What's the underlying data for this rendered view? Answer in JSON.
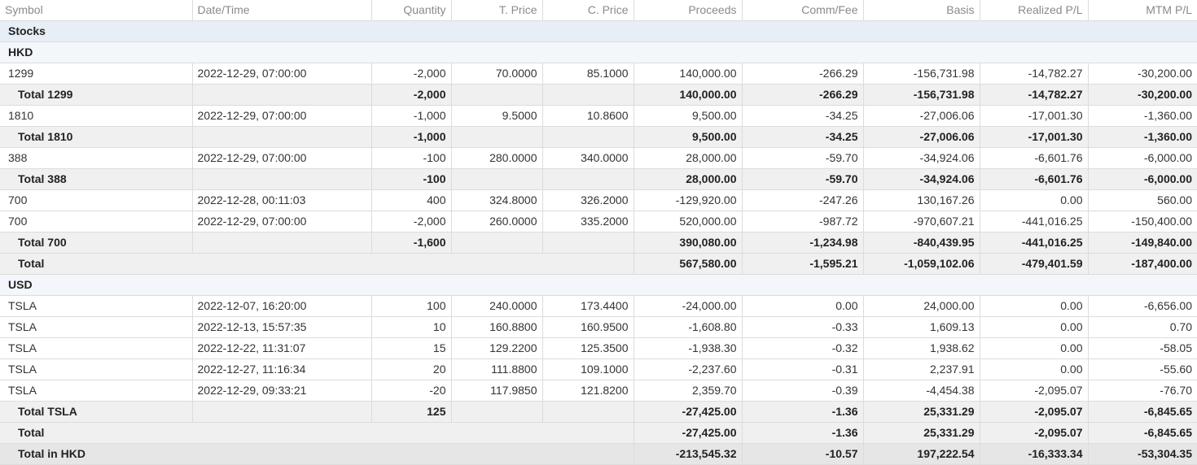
{
  "headers": [
    "Symbol",
    "Date/Time",
    "Quantity",
    "T. Price",
    "C. Price",
    "Proceeds",
    "Comm/Fee",
    "Basis",
    "Realized P/L",
    "MTM P/L"
  ],
  "section_label": "Stocks",
  "hkd": {
    "label": "HKD",
    "rows": [
      {
        "type": "row",
        "symbol": "1299",
        "datetime": "2022-12-29, 07:00:00",
        "qty": "-2,000",
        "tprice": "70.0000",
        "cprice": "85.1000",
        "proceeds": "140,000.00",
        "comm": "-266.29",
        "basis": "-156,731.98",
        "realized": "-14,782.27",
        "mtm": "-30,200.00"
      },
      {
        "type": "total",
        "symbol": "Total 1299",
        "datetime": "",
        "qty": "-2,000",
        "tprice": "",
        "cprice": "",
        "proceeds": "140,000.00",
        "comm": "-266.29",
        "basis": "-156,731.98",
        "realized": "-14,782.27",
        "mtm": "-30,200.00"
      },
      {
        "type": "row",
        "symbol": "1810",
        "datetime": "2022-12-29, 07:00:00",
        "qty": "-1,000",
        "tprice": "9.5000",
        "cprice": "10.8600",
        "proceeds": "9,500.00",
        "comm": "-34.25",
        "basis": "-27,006.06",
        "realized": "-17,001.30",
        "mtm": "-1,360.00"
      },
      {
        "type": "total",
        "symbol": "Total 1810",
        "datetime": "",
        "qty": "-1,000",
        "tprice": "",
        "cprice": "",
        "proceeds": "9,500.00",
        "comm": "-34.25",
        "basis": "-27,006.06",
        "realized": "-17,001.30",
        "mtm": "-1,360.00"
      },
      {
        "type": "row",
        "symbol": "388",
        "datetime": "2022-12-29, 07:00:00",
        "qty": "-100",
        "tprice": "280.0000",
        "cprice": "340.0000",
        "proceeds": "28,000.00",
        "comm": "-59.70",
        "basis": "-34,924.06",
        "realized": "-6,601.76",
        "mtm": "-6,000.00"
      },
      {
        "type": "total",
        "symbol": "Total 388",
        "datetime": "",
        "qty": "-100",
        "tprice": "",
        "cprice": "",
        "proceeds": "28,000.00",
        "comm": "-59.70",
        "basis": "-34,924.06",
        "realized": "-6,601.76",
        "mtm": "-6,000.00"
      },
      {
        "type": "row",
        "symbol": "700",
        "datetime": "2022-12-28, 00:11:03",
        "qty": "400",
        "tprice": "324.8000",
        "cprice": "326.2000",
        "proceeds": "-129,920.00",
        "comm": "-247.26",
        "basis": "130,167.26",
        "realized": "0.00",
        "mtm": "560.00"
      },
      {
        "type": "row",
        "symbol": "700",
        "datetime": "2022-12-29, 07:00:00",
        "qty": "-2,000",
        "tprice": "260.0000",
        "cprice": "335.2000",
        "proceeds": "520,000.00",
        "comm": "-987.72",
        "basis": "-970,607.21",
        "realized": "-441,016.25",
        "mtm": "-150,400.00"
      },
      {
        "type": "total",
        "symbol": "Total 700",
        "datetime": "",
        "qty": "-1,600",
        "tprice": "",
        "cprice": "",
        "proceeds": "390,080.00",
        "comm": "-1,234.98",
        "basis": "-840,439.95",
        "realized": "-441,016.25",
        "mtm": "-149,840.00"
      }
    ],
    "total": {
      "label": "Total",
      "proceeds": "567,580.00",
      "comm": "-1,595.21",
      "basis": "-1,059,102.06",
      "realized": "-479,401.59",
      "mtm": "-187,400.00"
    }
  },
  "usd": {
    "label": "USD",
    "rows": [
      {
        "type": "row",
        "symbol": "TSLA",
        "datetime": "2022-12-07, 16:20:00",
        "qty": "100",
        "tprice": "240.0000",
        "cprice": "173.4400",
        "proceeds": "-24,000.00",
        "comm": "0.00",
        "basis": "24,000.00",
        "realized": "0.00",
        "mtm": "-6,656.00"
      },
      {
        "type": "row",
        "symbol": "TSLA",
        "datetime": "2022-12-13, 15:57:35",
        "qty": "10",
        "tprice": "160.8800",
        "cprice": "160.9500",
        "proceeds": "-1,608.80",
        "comm": "-0.33",
        "basis": "1,609.13",
        "realized": "0.00",
        "mtm": "0.70"
      },
      {
        "type": "row",
        "symbol": "TSLA",
        "datetime": "2022-12-22, 11:31:07",
        "qty": "15",
        "tprice": "129.2200",
        "cprice": "125.3500",
        "proceeds": "-1,938.30",
        "comm": "-0.32",
        "basis": "1,938.62",
        "realized": "0.00",
        "mtm": "-58.05"
      },
      {
        "type": "row",
        "symbol": "TSLA",
        "datetime": "2022-12-27, 11:16:34",
        "qty": "20",
        "tprice": "111.8800",
        "cprice": "109.1000",
        "proceeds": "-2,237.60",
        "comm": "-0.31",
        "basis": "2,237.91",
        "realized": "0.00",
        "mtm": "-55.60"
      },
      {
        "type": "row",
        "symbol": "TSLA",
        "datetime": "2022-12-29, 09:33:21",
        "qty": "-20",
        "tprice": "117.9850",
        "cprice": "121.8200",
        "proceeds": "2,359.70",
        "comm": "-0.39",
        "basis": "-4,454.38",
        "realized": "-2,095.07",
        "mtm": "-76.70"
      },
      {
        "type": "total",
        "symbol": "Total TSLA",
        "datetime": "",
        "qty": "125",
        "tprice": "",
        "cprice": "",
        "proceeds": "-27,425.00",
        "comm": "-1.36",
        "basis": "25,331.29",
        "realized": "-2,095.07",
        "mtm": "-6,845.65"
      }
    ],
    "total": {
      "label": "Total",
      "proceeds": "-27,425.00",
      "comm": "-1.36",
      "basis": "25,331.29",
      "realized": "-2,095.07",
      "mtm": "-6,845.65"
    }
  },
  "grand_total": {
    "label": "Total in HKD",
    "proceeds": "-213,545.32",
    "comm": "-10.57",
    "basis": "197,222.54",
    "realized": "-16,333.34",
    "mtm": "-53,304.35"
  }
}
